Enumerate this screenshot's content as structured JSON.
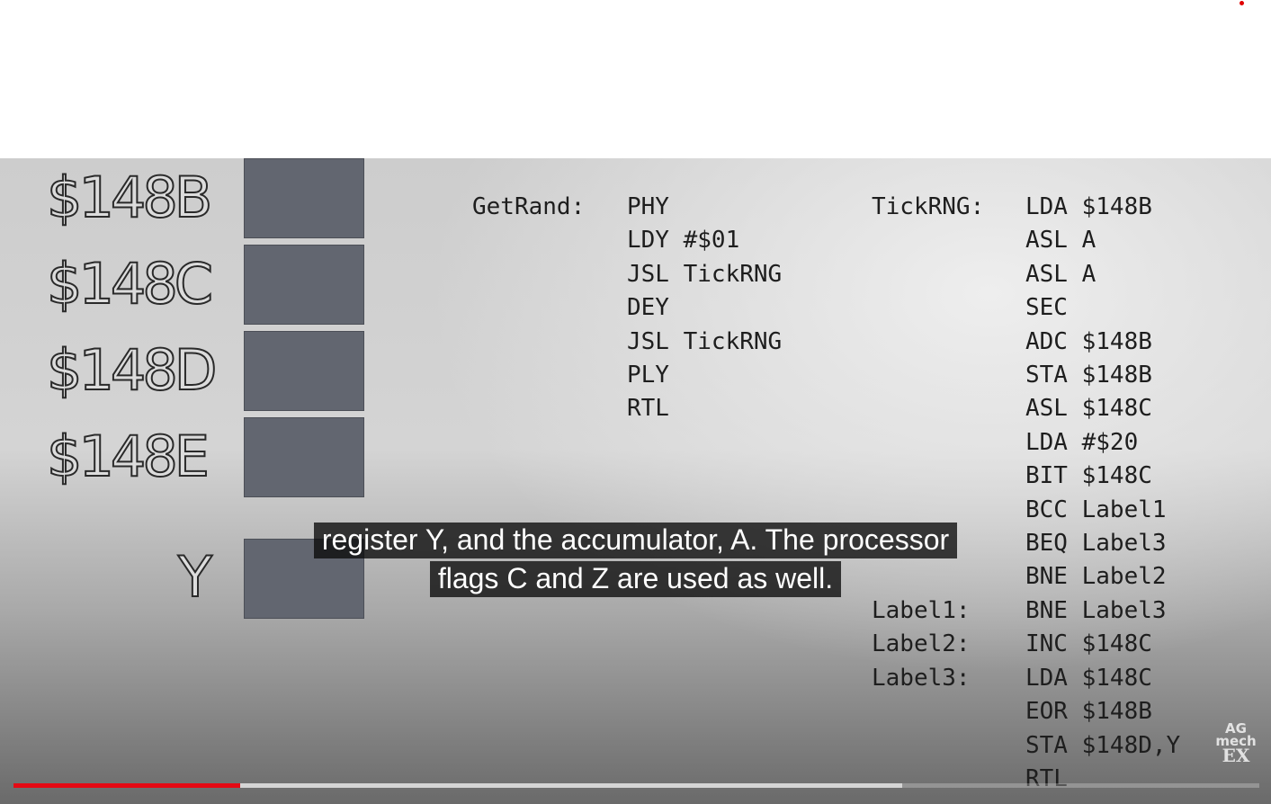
{
  "registers": [
    {
      "label": "$148B"
    },
    {
      "label": "$148C"
    },
    {
      "label": "$148D"
    },
    {
      "label": "$148E"
    },
    {
      "label": "Y"
    }
  ],
  "getrand": {
    "label": "GetRand:",
    "lines": [
      "PHY",
      "LDY #$01",
      "JSL TickRNG",
      "DEY",
      "JSL TickRNG",
      "PLY",
      "RTL"
    ]
  },
  "tickrng": {
    "labels": [
      "TickRNG:",
      "",
      "",
      "",
      "",
      "",
      "",
      "",
      "",
      "",
      "",
      "",
      "Label1:",
      "Label2:",
      "Label3:",
      "",
      "",
      ""
    ],
    "lines": [
      "LDA $148B",
      "ASL A",
      "ASL A",
      "SEC",
      "ADC $148B",
      "STA $148B",
      "ASL $148C",
      "LDA #$20",
      "BIT $148C",
      "BCC Label1",
      "BEQ Label3",
      "BNE Label2",
      "BNE Label3",
      "INC $148C",
      "LDA $148C",
      "EOR $148B",
      "STA $148D,Y",
      "RTL"
    ]
  },
  "caption": {
    "line1": "register Y, and the accumulator, A. The processor",
    "line2": "flags C and Z are used as well."
  },
  "watermark": {
    "line1": "AG",
    "line2": "mech",
    "line3": "EX"
  },
  "progress": {
    "played_fraction": 0.182,
    "buffered_fraction": 0.713
  },
  "colors": {
    "progress_played": "#e50914",
    "register_box": "#626670"
  }
}
